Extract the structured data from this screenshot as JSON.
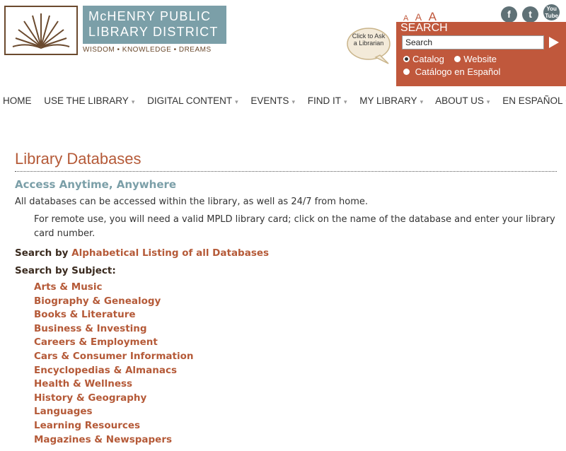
{
  "header": {
    "logo": {
      "line1": "McHENRY PUBLIC",
      "line2": "LIBRARY DISTRICT",
      "tagline": "WISDOM • KNOWLEDGE • DREAMS"
    },
    "ask_librarian": "Click to Ask a Librarian",
    "font_sizes": [
      "A",
      "A",
      "A"
    ],
    "social": [
      "f",
      "t",
      "You Tube"
    ],
    "search": {
      "label": "SEARCH",
      "placeholder": "Search",
      "options": [
        "Catalog",
        "Website",
        "Catálogo en Español"
      ],
      "selected": "Catalog"
    }
  },
  "nav": {
    "items": [
      "HOME",
      "USE THE LIBRARY",
      "DIGITAL CONTENT",
      "EVENTS",
      "FIND IT",
      "MY LIBRARY",
      "ABOUT US",
      "EN ESPAÑOL"
    ]
  },
  "content": {
    "title": "Library Databases",
    "subtitle": "Access Anytime, Anywhere",
    "intro": "All databases can be accessed within the library, as well as 24/7 from home.",
    "remote": "For remote use, you will need a valid MPLD library card; click on the name of the database and enter your library card number.",
    "search_by_prefix": "Search by",
    "alpha_link": "Alphabetical Listing of all Databases",
    "search_by_subject": "Search by Subject:",
    "subjects": [
      "Arts & Music",
      "Biography & Genealogy",
      "Books & Literature",
      "Business & Investing",
      "Careers & Employment",
      "Cars & Consumer Information",
      "Encyclopedias & Almanacs",
      "Health & Wellness",
      "History & Geography",
      "Languages",
      "Learning Resources",
      "Magazines & Newspapers"
    ]
  },
  "colors": {
    "accent": "#c0583c",
    "teal": "#7b9fa8",
    "brown": "#6b4a2e"
  }
}
